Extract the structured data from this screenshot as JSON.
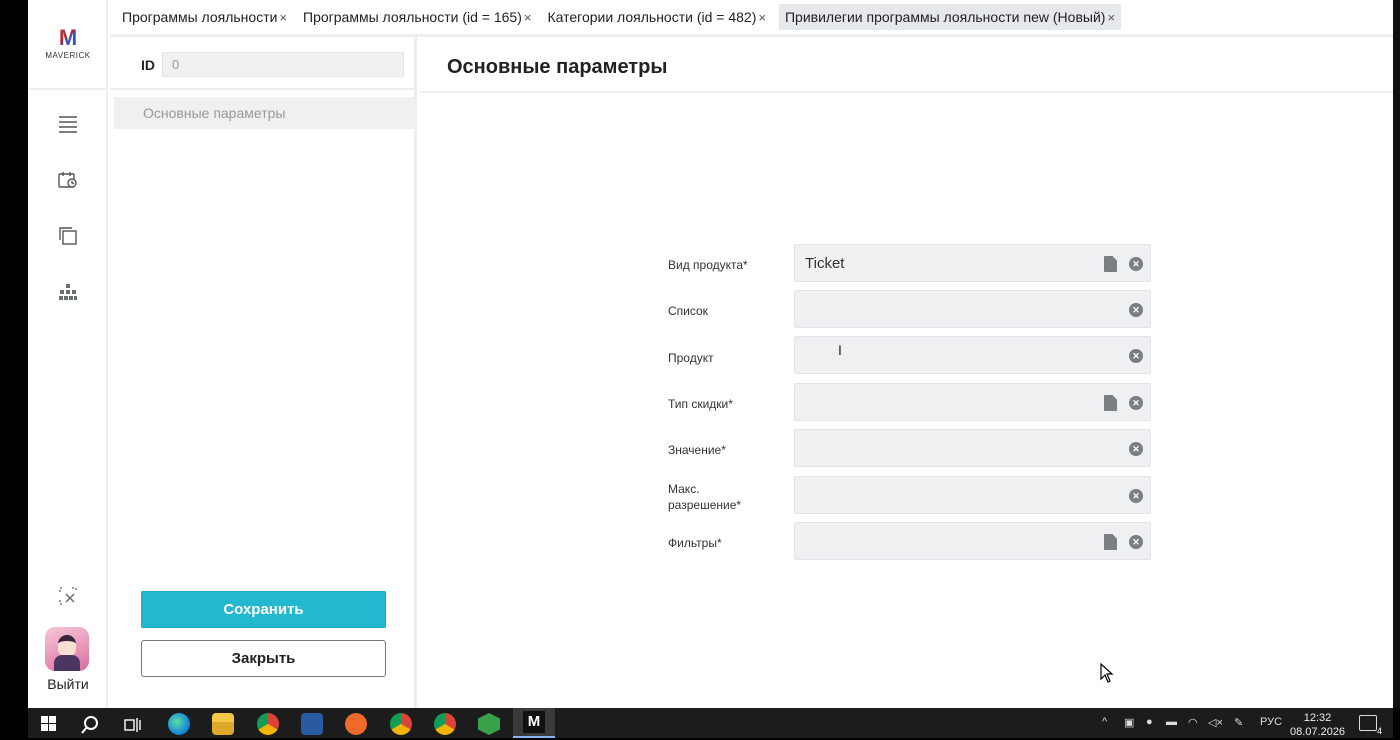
{
  "app": {
    "brand": "MAVERICK",
    "logo_letter": "M"
  },
  "rail": {
    "logout_label": "Выйти"
  },
  "tabs": [
    {
      "label": "Программы лояльности",
      "close": "×"
    },
    {
      "label": "Программы лояльности (id = 165)",
      "close": "×"
    },
    {
      "label": "Категории лояльности (id = 482)",
      "close": "×"
    },
    {
      "label": "Привилегии программы лояльности new (Новый)",
      "close": "×",
      "active": true
    }
  ],
  "sidebar": {
    "id_label": "ID",
    "id_value": "0",
    "nav_items": [
      {
        "label": "Основные параметры"
      }
    ],
    "save_label": "Сохранить",
    "close_label": "Закрыть"
  },
  "main": {
    "title": "Основные параметры",
    "fields": [
      {
        "label": "Вид продукта*",
        "value": "Ticket",
        "has_doc": true
      },
      {
        "label": "Список",
        "value": "",
        "has_doc": false
      },
      {
        "label": "Продукт",
        "value": "",
        "has_doc": false
      },
      {
        "label": "Тип скидки*",
        "value": "",
        "has_doc": true
      },
      {
        "label": "Значение*",
        "value": "",
        "has_doc": false
      },
      {
        "label": "Макс. разрешение*",
        "value": "",
        "has_doc": false
      },
      {
        "label": "Фильтры*",
        "value": "",
        "has_doc": true
      }
    ]
  },
  "taskbar": {
    "language": "РУС",
    "time": "12:32",
    "date": "08.07.2026",
    "notifications": "4"
  },
  "colors": {
    "accent": "#22b8cf",
    "field_bg": "#eef0f2",
    "border": "#eceff2"
  }
}
